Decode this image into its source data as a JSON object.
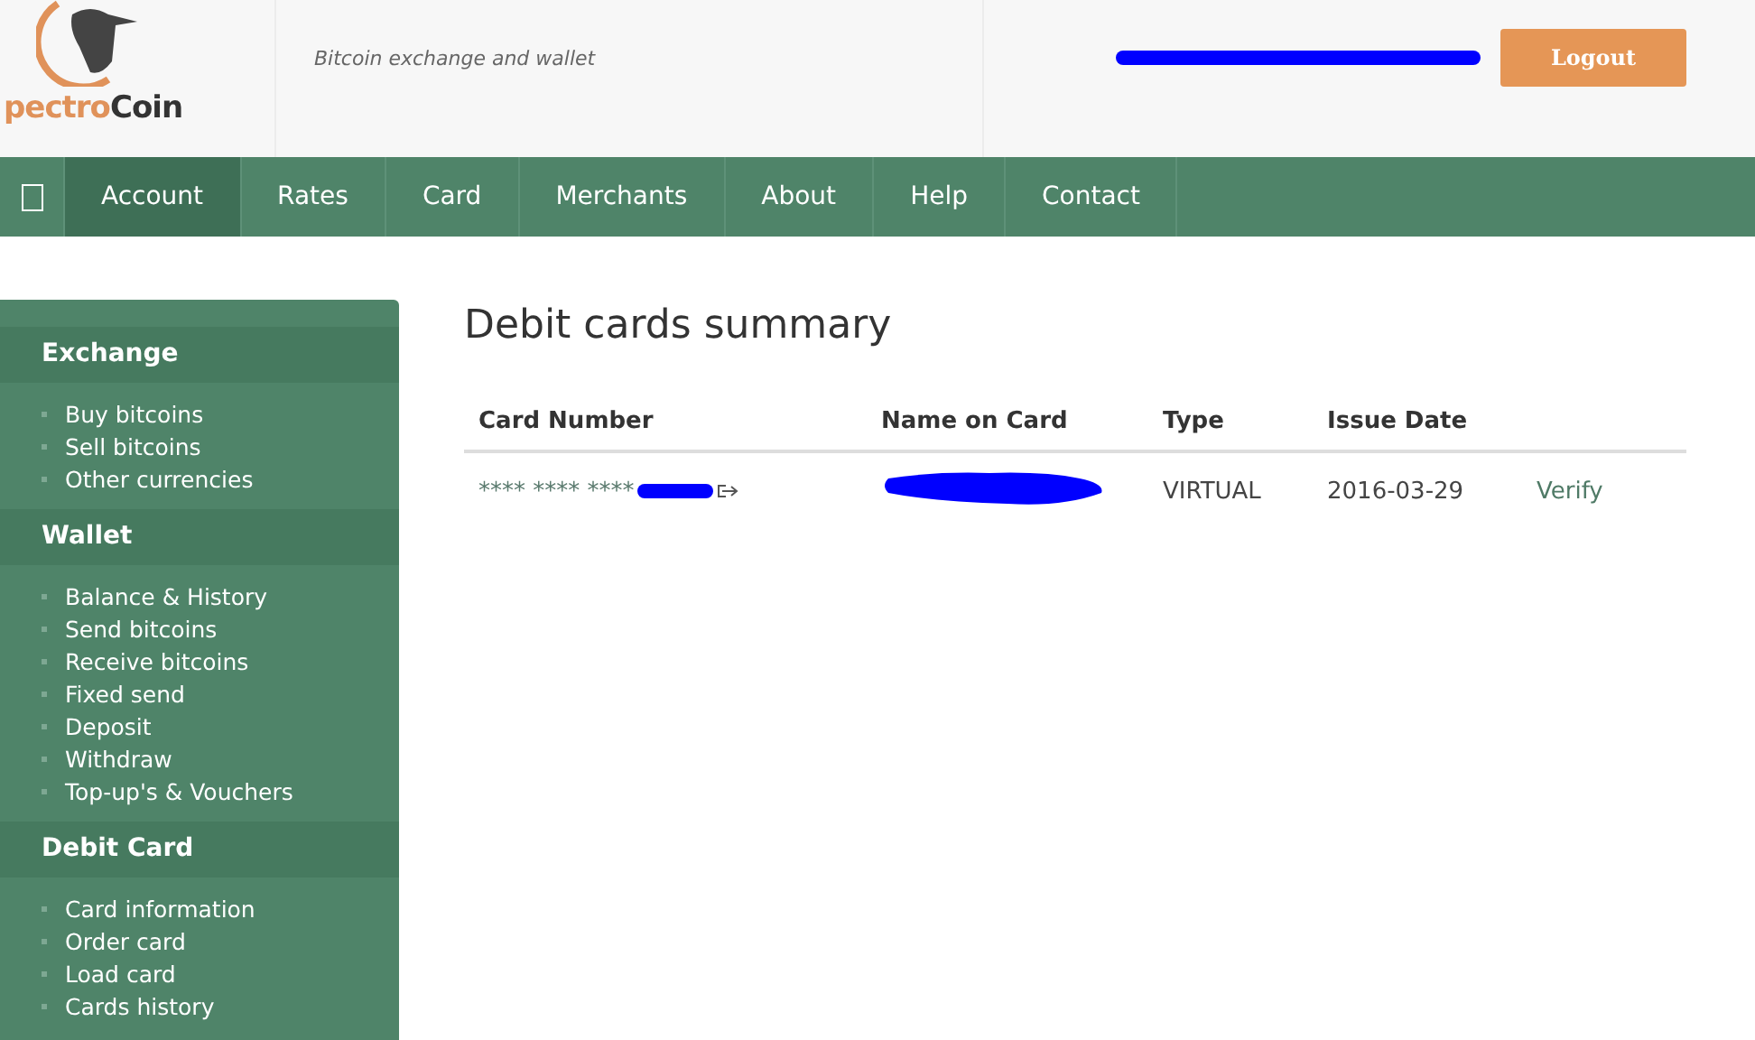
{
  "header": {
    "logo": {
      "part_1": "pectro",
      "part_2": "Coin"
    },
    "tagline": "Bitcoin exchange and wallet",
    "email_redacted": true,
    "logout": "Logout"
  },
  "nav": [
    {
      "label": "Account",
      "selected": true
    },
    {
      "label": "Rates",
      "selected": false
    },
    {
      "label": "Card",
      "selected": false
    },
    {
      "label": "Merchants",
      "selected": false
    },
    {
      "label": "About",
      "selected": false
    },
    {
      "label": "Help",
      "selected": false
    },
    {
      "label": "Contact",
      "selected": false
    }
  ],
  "sidebar": [
    {
      "title": "Exchange",
      "items": [
        "Buy bitcoins",
        "Sell bitcoins",
        "Other currencies"
      ]
    },
    {
      "title": "Wallet",
      "items": [
        "Balance & History",
        "Send bitcoins",
        "Receive bitcoins",
        "Fixed send",
        "Deposit",
        "Withdraw",
        "Top-up's & Vouchers"
      ]
    },
    {
      "title": "Debit Card",
      "items": [
        "Card information",
        "Order card",
        "Load card",
        "Cards history"
      ]
    }
  ],
  "main": {
    "title": "Debit cards summary",
    "table": {
      "columns": [
        "Card Number",
        "Name on Card",
        "Type",
        "Issue Date"
      ],
      "rows": [
        {
          "card_number": "**** **** ****",
          "number_redacted": true,
          "name_redacted": true,
          "type": "VIRTUAL",
          "issue_date": "2016-03-29",
          "action": "Verify"
        }
      ]
    }
  }
}
